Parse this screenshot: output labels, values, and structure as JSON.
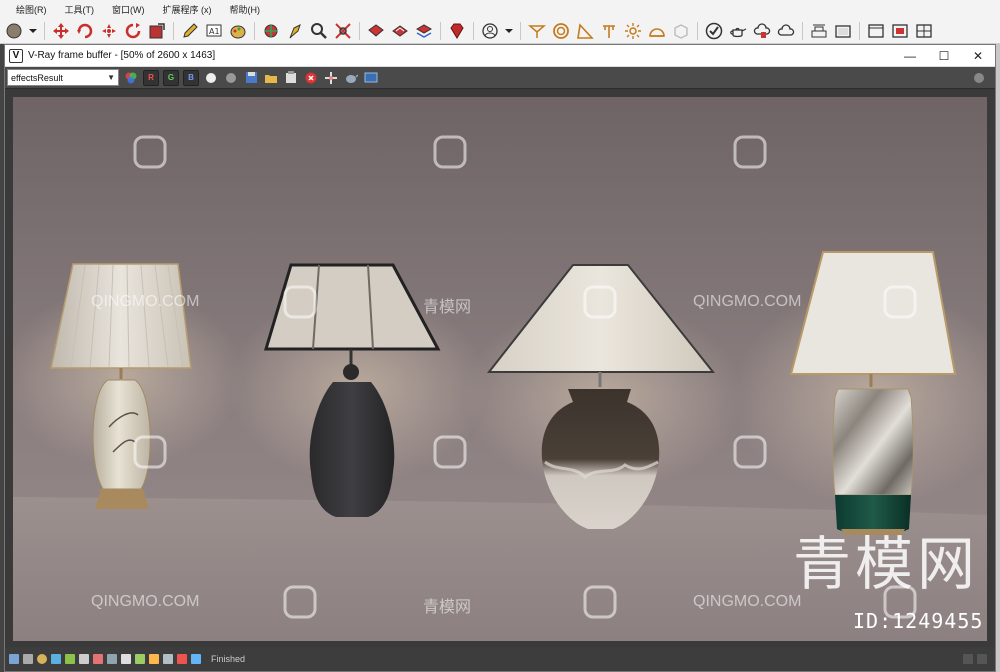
{
  "menu": [
    "绘图(R)",
    "工具(T)",
    "窗口(W)",
    "扩展程序 (x)",
    "帮助(H)"
  ],
  "toolbar_icons": [
    "sphere-icon",
    "dropdown-icon",
    "move-icon",
    "rotate-icon",
    "scale-icon",
    "orbit-icon",
    "select-icon",
    "pencil-icon",
    "text-icon",
    "paint-icon",
    "eye-icon",
    "walk-icon",
    "zoom-icon",
    "zoom-extents-icon",
    "component-icon",
    "group-icon",
    "layer-icon",
    "ruby-icon",
    "user-icon",
    "dropdown-icon",
    "section-icon",
    "circle-icon",
    "protractor-icon",
    "axes-icon",
    "sun-icon",
    "dome-icon",
    "box-icon",
    "check-icon",
    "teapot-icon",
    "cloud-hand-icon",
    "cloud-icon",
    "render-icon",
    "cube-icon",
    "window-icon",
    "frame-icon",
    "tile-icon"
  ],
  "vfb": {
    "title": "V-Ray frame buffer - [50% of 2600 x 1463]",
    "logo": "V",
    "minimize": "—",
    "maximize": "☐",
    "close": "✕",
    "channel": "effectsResult",
    "btn_r": "R",
    "btn_g": "G",
    "btn_b": "B",
    "status_text": "Finished"
  },
  "watermarks": {
    "site_latin": "QINGMO.COM",
    "site_cn": "青模网",
    "big_cn": "青模网",
    "id_text": "ID:1249455"
  },
  "colors": {
    "wall": "#8e8182",
    "floor": "#9a8d8c",
    "shade": "#e7e2da",
    "accent_red": "#d43a2a"
  }
}
